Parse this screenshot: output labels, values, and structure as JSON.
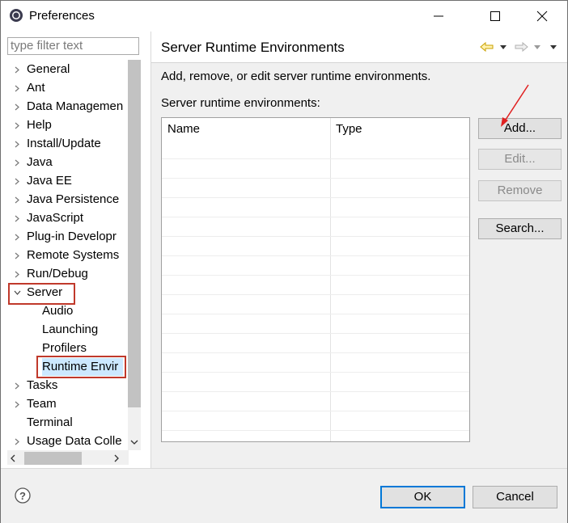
{
  "window": {
    "title": "Preferences"
  },
  "sidebar": {
    "filter_placeholder": "type filter text",
    "items": [
      {
        "label": "General",
        "arrow": ">"
      },
      {
        "label": "Ant",
        "arrow": ">"
      },
      {
        "label": "Data Managemen",
        "arrow": ">"
      },
      {
        "label": "Help",
        "arrow": ">"
      },
      {
        "label": "Install/Update",
        "arrow": ">"
      },
      {
        "label": "Java",
        "arrow": ">"
      },
      {
        "label": "Java EE",
        "arrow": ">"
      },
      {
        "label": "Java Persistence",
        "arrow": ">"
      },
      {
        "label": "JavaScript",
        "arrow": ">"
      },
      {
        "label": "Plug-in Developr",
        "arrow": ">"
      },
      {
        "label": "Remote Systems",
        "arrow": ">"
      },
      {
        "label": "Run/Debug",
        "arrow": ">"
      },
      {
        "label": "Server",
        "arrow": "v"
      },
      {
        "label": "Audio",
        "arrow": ""
      },
      {
        "label": "Launching",
        "arrow": ""
      },
      {
        "label": "Profilers",
        "arrow": ""
      },
      {
        "label": "Runtime Envir",
        "arrow": "",
        "selected": true
      },
      {
        "label": "Tasks",
        "arrow": ">"
      },
      {
        "label": "Team",
        "arrow": ">"
      },
      {
        "label": "Terminal",
        "arrow": ""
      },
      {
        "label": "Usage Data Colle",
        "arrow": ">"
      }
    ]
  },
  "page": {
    "title": "Server Runtime Environments",
    "description": "Add, remove, or edit server runtime environments.",
    "list_label": "Server runtime environments:",
    "columns": [
      "Name",
      "Type"
    ],
    "buttons": {
      "add": "Add...",
      "edit": "Edit...",
      "remove": "Remove",
      "search": "Search..."
    }
  },
  "footer": {
    "ok": "OK",
    "cancel": "Cancel"
  },
  "colors": {
    "highlight": "#c0392b",
    "arrow": "#e02020",
    "focus": "#0078d7"
  }
}
